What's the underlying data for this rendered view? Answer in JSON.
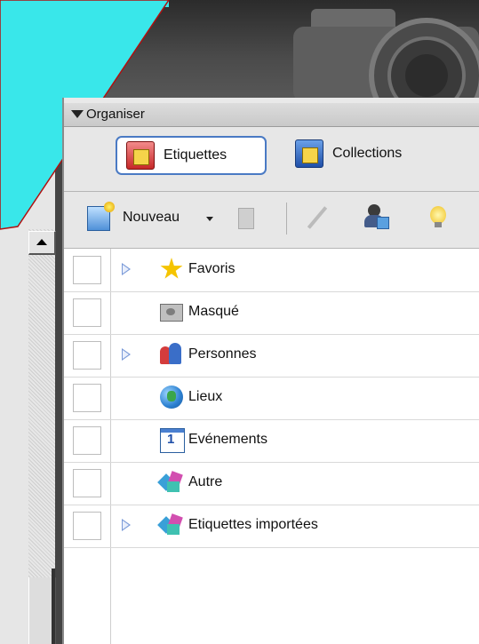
{
  "organiser": {
    "title": "Organiser",
    "tabs": [
      {
        "label": "Etiquettes",
        "icon": "tag-icon",
        "active": true
      },
      {
        "label": "Collections",
        "icon": "collection-icon",
        "active": false
      }
    ]
  },
  "toolbar": {
    "new_label": "Nouveau",
    "new_icon": "new-tag-icon",
    "icons": [
      "delete-icon",
      "edit-icon",
      "find-faces-icon",
      "bulb-icon"
    ]
  },
  "tags": [
    {
      "label": "Favoris",
      "icon": "star-icon",
      "expandable": true
    },
    {
      "label": "Masqué",
      "icon": "hidden-icon",
      "expandable": false
    },
    {
      "label": "Personnes",
      "icon": "people-icon",
      "expandable": true
    },
    {
      "label": "Lieux",
      "icon": "globe-icon",
      "expandable": false
    },
    {
      "label": "Evénements",
      "icon": "calendar-icon",
      "expandable": false
    },
    {
      "label": "Autre",
      "icon": "other-icon",
      "expandable": false
    },
    {
      "label": "Etiquettes importées",
      "icon": "imported-tags-icon",
      "expandable": true
    }
  ],
  "colors": {
    "header_bg": "#3a3a3a",
    "accent_cyan": "#39e7ea",
    "selection_border": "#4a7ac4",
    "expander": "#7a9ad8"
  }
}
